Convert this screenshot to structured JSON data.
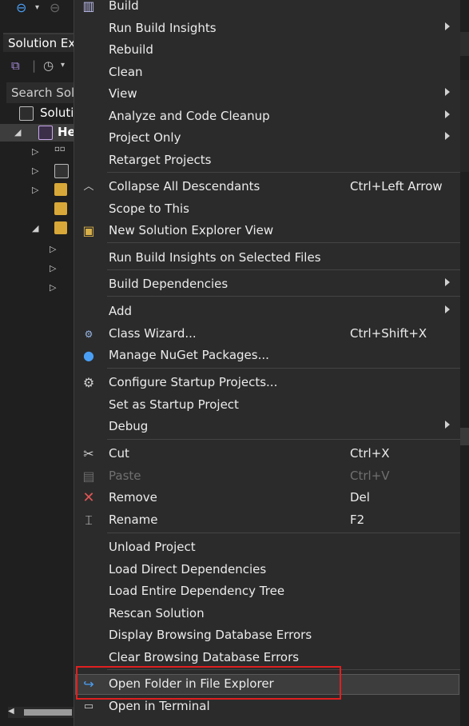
{
  "background": {
    "solution_explorer_tab": "Solution Ex",
    "search_placeholder": "Search Sol",
    "solution_node": "Soluti",
    "project_node": "He"
  },
  "menu": {
    "items": [
      {
        "label": "Build"
      },
      {
        "label": "Run Build Insights",
        "submenu": true
      },
      {
        "label": "Rebuild"
      },
      {
        "label": "Clean"
      },
      {
        "label": "View",
        "submenu": true
      },
      {
        "label": "Analyze and Code Cleanup",
        "submenu": true
      },
      {
        "label": "Project Only",
        "submenu": true
      },
      {
        "label": "Retarget Projects"
      },
      {
        "label": "Collapse All Descendants",
        "shortcut": "Ctrl+Left Arrow"
      },
      {
        "label": "Scope to This"
      },
      {
        "label": "New Solution Explorer View"
      },
      {
        "label": "Run Build Insights on Selected Files"
      },
      {
        "label": "Build Dependencies",
        "submenu": true
      },
      {
        "label": "Add",
        "submenu": true
      },
      {
        "label": "Class Wizard...",
        "shortcut": "Ctrl+Shift+X"
      },
      {
        "label": "Manage NuGet Packages..."
      },
      {
        "label": "Configure Startup Projects..."
      },
      {
        "label": "Set as Startup Project"
      },
      {
        "label": "Debug",
        "submenu": true
      },
      {
        "label": "Cut",
        "shortcut": "Ctrl+X"
      },
      {
        "label": "Paste",
        "shortcut": "Ctrl+V",
        "disabled": true
      },
      {
        "label": "Remove",
        "shortcut": "Del"
      },
      {
        "label": "Rename",
        "shortcut": "F2"
      },
      {
        "label": "Unload Project"
      },
      {
        "label": "Load Direct Dependencies"
      },
      {
        "label": "Load Entire Dependency Tree"
      },
      {
        "label": "Rescan Solution"
      },
      {
        "label": "Display Browsing Database Errors"
      },
      {
        "label": "Clear Browsing Database Errors"
      },
      {
        "label": "Open Folder in File Explorer",
        "highlighted": true
      },
      {
        "label": "Open in Terminal"
      }
    ]
  },
  "colors": {
    "menu_bg": "#2b2b2b",
    "highlight_box": "#e02020",
    "accent": "#4a9ff5"
  }
}
